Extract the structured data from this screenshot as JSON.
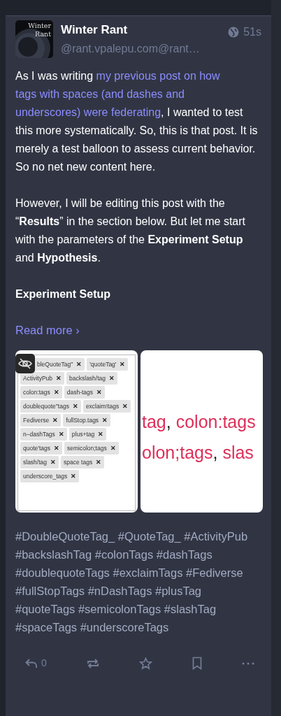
{
  "post": {
    "avatar": {
      "caption_line_1": "Winter",
      "caption_line_2": "Rant"
    },
    "display_name": "Winter Rant",
    "handle": "@rant.vpalepu.com@rant…",
    "public": true,
    "time": "51s",
    "paragraphs": [
      [
        {
          "kind": "text",
          "text": "As I was writing "
        },
        {
          "kind": "link",
          "text": "my previous post on how"
        },
        {
          "kind": "link",
          "text": "tags with spaces (and dashes and"
        },
        {
          "kind": "link",
          "text": "underscores) were federating"
        },
        {
          "kind": "text",
          "text": ", I wanted to test this more systematically. So, this is that post. It is merely a test balloon to assess current behavior. So no net new content here."
        }
      ],
      "However, I will be editing this post with the “**Results**” in the section below. But let me start with the parameters of the **Experiment Setup** and **Hypothesis**.",
      "**Experiment Setup**"
    ],
    "read_more": "Read more ›",
    "media": [
      {
        "kind": "tag-editor",
        "hidden_toggle": true,
        "chips": [
          "bleQuoteTag\"",
          "'quoteTag'",
          "ActivityPub",
          "backslash/tag",
          "colon:tags",
          "dash-tags",
          "doublequote\"tags",
          "exclaim!tags",
          "Fediverse",
          "fullStop.tags",
          "n–dashTags",
          "plus+tag",
          "quote'tags",
          "semicolon;tags",
          "slash/tag",
          "space tags",
          "underscore_tags"
        ],
        "chip_remove": "✕"
      },
      {
        "kind": "text-crop",
        "lines": [
          [
            {
              "text": "tag",
              "kind": "tag"
            },
            {
              "text": ", ",
              "kind": "punct"
            },
            {
              "text": "colon:tags",
              "kind": "tag"
            }
          ],
          [
            {
              "text": "olon;tags",
              "kind": "tag"
            },
            {
              "text": ", ",
              "kind": "punct"
            },
            {
              "text": "slas",
              "kind": "tag"
            }
          ]
        ]
      }
    ],
    "hashtags": [
      "#DoubleQuoteTag_",
      "#QuoteTag_",
      "#ActivityPub",
      "#backslashTag",
      "#colonTags",
      "#dashTags",
      "#doublequoteTags",
      "#exclaimTags",
      "#Fediverse",
      "#fullStopTags",
      "#nDashTags",
      "#plusTag",
      "#quoteTags",
      "#semicolonTags",
      "#slashTag",
      "#spaceTags",
      "#underscoreTags"
    ],
    "actions": [
      {
        "kind": "reply",
        "count": "0"
      },
      {
        "kind": "boost"
      },
      {
        "kind": "favourite"
      },
      {
        "kind": "bookmark"
      },
      {
        "kind": "more"
      }
    ]
  }
}
